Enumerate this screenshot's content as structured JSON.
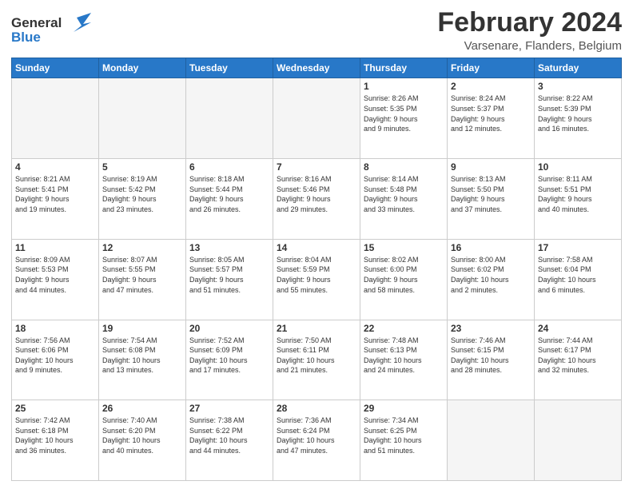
{
  "logo": {
    "line1": "General",
    "line2": "Blue"
  },
  "title": "February 2024",
  "location": "Varsenare, Flanders, Belgium",
  "days_header": [
    "Sunday",
    "Monday",
    "Tuesday",
    "Wednesday",
    "Thursday",
    "Friday",
    "Saturday"
  ],
  "weeks": [
    [
      {
        "day": "",
        "info": ""
      },
      {
        "day": "",
        "info": ""
      },
      {
        "day": "",
        "info": ""
      },
      {
        "day": "",
        "info": ""
      },
      {
        "day": "1",
        "info": "Sunrise: 8:26 AM\nSunset: 5:35 PM\nDaylight: 9 hours\nand 9 minutes."
      },
      {
        "day": "2",
        "info": "Sunrise: 8:24 AM\nSunset: 5:37 PM\nDaylight: 9 hours\nand 12 minutes."
      },
      {
        "day": "3",
        "info": "Sunrise: 8:22 AM\nSunset: 5:39 PM\nDaylight: 9 hours\nand 16 minutes."
      }
    ],
    [
      {
        "day": "4",
        "info": "Sunrise: 8:21 AM\nSunset: 5:41 PM\nDaylight: 9 hours\nand 19 minutes."
      },
      {
        "day": "5",
        "info": "Sunrise: 8:19 AM\nSunset: 5:42 PM\nDaylight: 9 hours\nand 23 minutes."
      },
      {
        "day": "6",
        "info": "Sunrise: 8:18 AM\nSunset: 5:44 PM\nDaylight: 9 hours\nand 26 minutes."
      },
      {
        "day": "7",
        "info": "Sunrise: 8:16 AM\nSunset: 5:46 PM\nDaylight: 9 hours\nand 29 minutes."
      },
      {
        "day": "8",
        "info": "Sunrise: 8:14 AM\nSunset: 5:48 PM\nDaylight: 9 hours\nand 33 minutes."
      },
      {
        "day": "9",
        "info": "Sunrise: 8:13 AM\nSunset: 5:50 PM\nDaylight: 9 hours\nand 37 minutes."
      },
      {
        "day": "10",
        "info": "Sunrise: 8:11 AM\nSunset: 5:51 PM\nDaylight: 9 hours\nand 40 minutes."
      }
    ],
    [
      {
        "day": "11",
        "info": "Sunrise: 8:09 AM\nSunset: 5:53 PM\nDaylight: 9 hours\nand 44 minutes."
      },
      {
        "day": "12",
        "info": "Sunrise: 8:07 AM\nSunset: 5:55 PM\nDaylight: 9 hours\nand 47 minutes."
      },
      {
        "day": "13",
        "info": "Sunrise: 8:05 AM\nSunset: 5:57 PM\nDaylight: 9 hours\nand 51 minutes."
      },
      {
        "day": "14",
        "info": "Sunrise: 8:04 AM\nSunset: 5:59 PM\nDaylight: 9 hours\nand 55 minutes."
      },
      {
        "day": "15",
        "info": "Sunrise: 8:02 AM\nSunset: 6:00 PM\nDaylight: 9 hours\nand 58 minutes."
      },
      {
        "day": "16",
        "info": "Sunrise: 8:00 AM\nSunset: 6:02 PM\nDaylight: 10 hours\nand 2 minutes."
      },
      {
        "day": "17",
        "info": "Sunrise: 7:58 AM\nSunset: 6:04 PM\nDaylight: 10 hours\nand 6 minutes."
      }
    ],
    [
      {
        "day": "18",
        "info": "Sunrise: 7:56 AM\nSunset: 6:06 PM\nDaylight: 10 hours\nand 9 minutes."
      },
      {
        "day": "19",
        "info": "Sunrise: 7:54 AM\nSunset: 6:08 PM\nDaylight: 10 hours\nand 13 minutes."
      },
      {
        "day": "20",
        "info": "Sunrise: 7:52 AM\nSunset: 6:09 PM\nDaylight: 10 hours\nand 17 minutes."
      },
      {
        "day": "21",
        "info": "Sunrise: 7:50 AM\nSunset: 6:11 PM\nDaylight: 10 hours\nand 21 minutes."
      },
      {
        "day": "22",
        "info": "Sunrise: 7:48 AM\nSunset: 6:13 PM\nDaylight: 10 hours\nand 24 minutes."
      },
      {
        "day": "23",
        "info": "Sunrise: 7:46 AM\nSunset: 6:15 PM\nDaylight: 10 hours\nand 28 minutes."
      },
      {
        "day": "24",
        "info": "Sunrise: 7:44 AM\nSunset: 6:17 PM\nDaylight: 10 hours\nand 32 minutes."
      }
    ],
    [
      {
        "day": "25",
        "info": "Sunrise: 7:42 AM\nSunset: 6:18 PM\nDaylight: 10 hours\nand 36 minutes."
      },
      {
        "day": "26",
        "info": "Sunrise: 7:40 AM\nSunset: 6:20 PM\nDaylight: 10 hours\nand 40 minutes."
      },
      {
        "day": "27",
        "info": "Sunrise: 7:38 AM\nSunset: 6:22 PM\nDaylight: 10 hours\nand 44 minutes."
      },
      {
        "day": "28",
        "info": "Sunrise: 7:36 AM\nSunset: 6:24 PM\nDaylight: 10 hours\nand 47 minutes."
      },
      {
        "day": "29",
        "info": "Sunrise: 7:34 AM\nSunset: 6:25 PM\nDaylight: 10 hours\nand 51 minutes."
      },
      {
        "day": "",
        "info": ""
      },
      {
        "day": "",
        "info": ""
      }
    ]
  ]
}
